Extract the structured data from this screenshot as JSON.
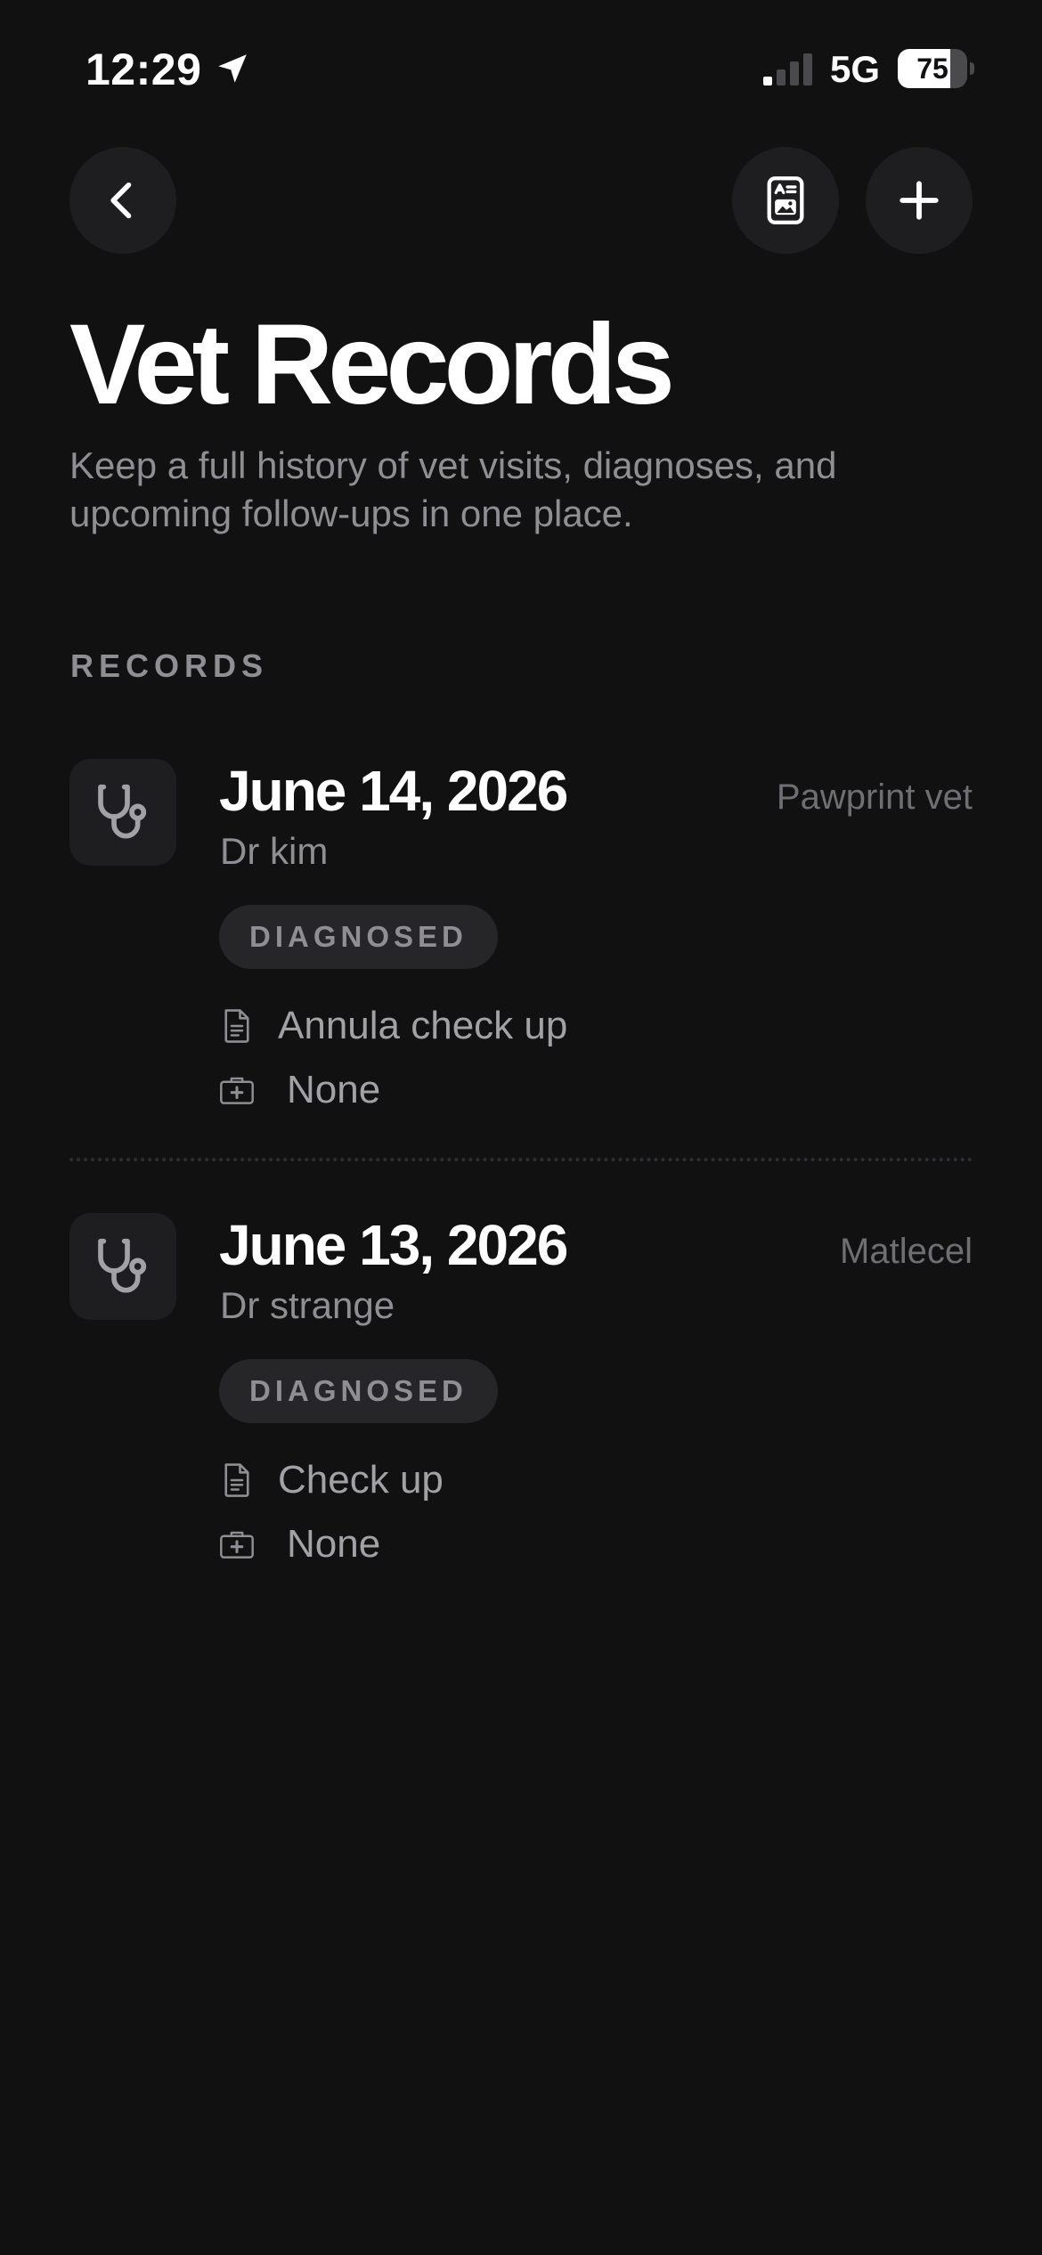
{
  "status_bar": {
    "time": "12:29",
    "network": "5G",
    "battery_level": "75",
    "battery_fraction": 0.75,
    "signal_bars_active": 1,
    "signal_bars_total": 4
  },
  "nav": {
    "back_icon": "chevron-left-icon",
    "report_icon": "document-report-icon",
    "add_icon": "plus-icon"
  },
  "header": {
    "title": "Vet Records",
    "subtitle": "Keep a full history of vet visits, diagnoses, and upcoming follow-ups in one place."
  },
  "section": {
    "label": "RECORDS"
  },
  "records": [
    {
      "date": "June 14, 2026",
      "vet": "Dr kim",
      "clinic": "Pawprint vet",
      "status": "DIAGNOSED",
      "reason": "Annula check up",
      "medication": "None",
      "icon": "stethoscope-icon"
    },
    {
      "date": "June 13, 2026",
      "vet": "Dr strange",
      "clinic": "Matlecel",
      "status": "DIAGNOSED",
      "reason": "Check up",
      "medication": "None",
      "icon": "stethoscope-icon"
    }
  ],
  "colors": {
    "background": "#111112",
    "surface": "#1e1e20",
    "primary_text": "#ffffff",
    "secondary_text": "#8e8e93",
    "tertiary_text": "#6e6e73",
    "badge_background": "#262628"
  }
}
